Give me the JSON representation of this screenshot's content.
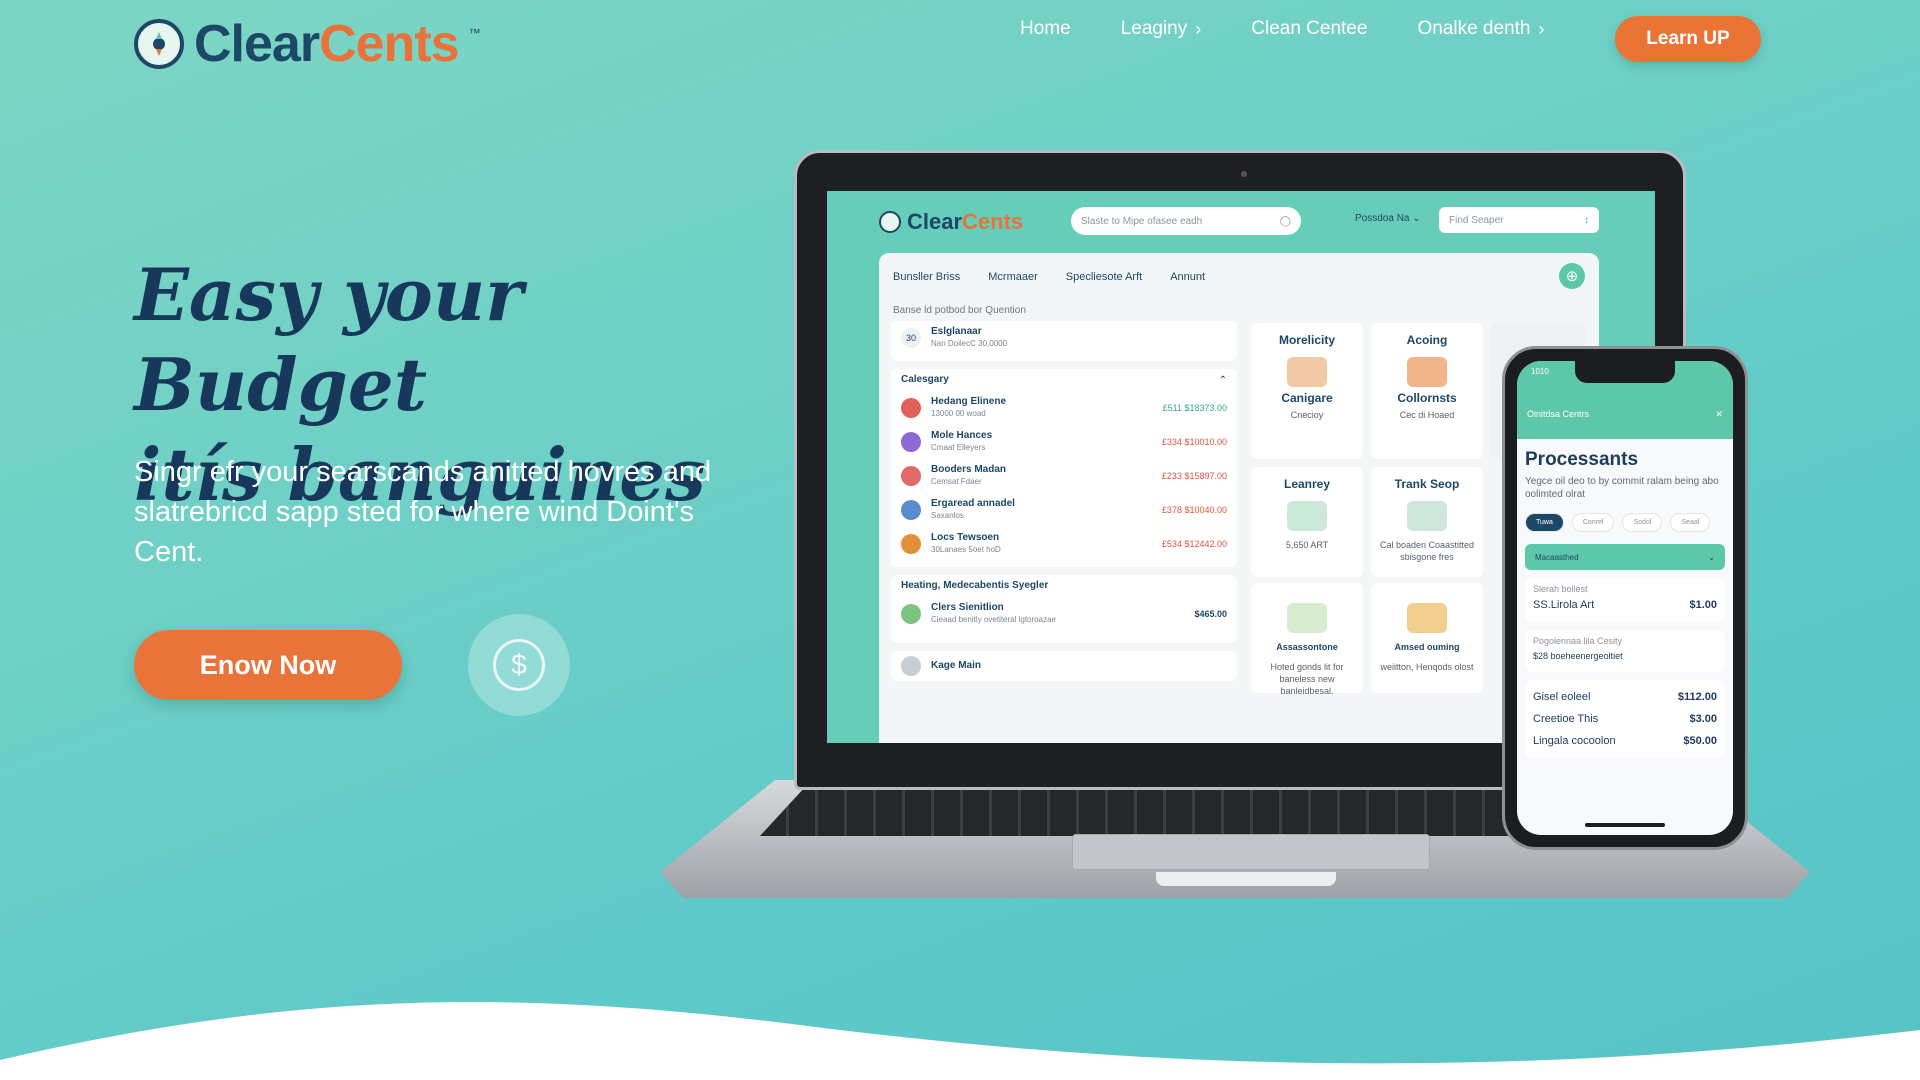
{
  "brand": {
    "name_a": "Clear",
    "name_b": "Cents",
    "tm": "™"
  },
  "nav": {
    "items": [
      {
        "label": "Home",
        "chevron": false
      },
      {
        "label": "Leaginy",
        "chevron": true
      },
      {
        "label": "Clean Centee",
        "chevron": false
      },
      {
        "label": "Onalke denth",
        "chevron": true
      }
    ],
    "chevron_glyph": "›",
    "cta": "Learn UP"
  },
  "hero": {
    "title_line1": "Easy your Budget",
    "title_line2": "itís banguines",
    "subtitle": "Singr efr your searscands anitted hovres and slatrebricd sapp sted for where wind Doint's Cent.",
    "cta": "Enow Now",
    "coin_symbol": "$"
  },
  "laptop": {
    "logo_a": "Clear",
    "logo_b": "Cents",
    "search_placeholder": "Slaste to Mipe ofasee eadh",
    "dropdown": "Possdoa Na",
    "find_placeholder": "Find Seaper",
    "tabs": [
      "Bunsller Briss",
      "Mcrmaaer",
      "Specliesote Arft",
      "Annunt"
    ],
    "breadcrumb": "Banse ld potbod bor Quention",
    "top_row": {
      "badge": "30",
      "title": "Eslglanaar",
      "sub": "Nan DoilecC 30,0000"
    },
    "category_header": "Calesgary",
    "rows": [
      {
        "title": "Hedang Elinene",
        "sub": "13000 00 woad",
        "amount": "£511 $18373.00",
        "positive": true,
        "color": "#e0615a"
      },
      {
        "title": "Mole Hances",
        "sub": "Cmaat Elleyers",
        "amount": "£334 $10010.00",
        "positive": false,
        "color": "#8b6bd1"
      },
      {
        "title": "Booders Madan",
        "sub": "Cemsat Fdaer",
        "amount": "£233 $15897.00",
        "positive": false,
        "color": "#e06a68"
      },
      {
        "title": "Ergaread annadel",
        "sub": "Saxanlos",
        "amount": "£378 $10040.00",
        "positive": false,
        "color": "#5a8bd0"
      },
      {
        "title": "Locs Tewsoen",
        "sub": "30Lanaes 5oet hoD",
        "amount": "£534 $12442.00",
        "positive": false,
        "color": "#e4903a"
      }
    ],
    "section2_title": "Heating, Medecabentis Syegler",
    "section2_row": {
      "title": "Clers Sienitlion",
      "sub": "Cieaad benitly ovetiteral lgtoroazae",
      "amount": "$465.00"
    },
    "section3_row": "Kage Main",
    "tiles": [
      {
        "title": "Morelicity",
        "label": "Canigare",
        "sub": "Cnecioy"
      },
      {
        "title": "Acoing",
        "label": "Collornsts",
        "sub": "Cec di Hoaed"
      },
      {
        "title": "Leanrey",
        "label": "5,650 ART",
        "sub": ""
      },
      {
        "title": "Trank Seop",
        "label": "",
        "sub": "Cal boaden Coaastitted sbisgone fres"
      },
      {
        "title": "",
        "label": "Assassontone",
        "sub": "Hoted gonds lit for baneless new banleidbesal."
      },
      {
        "title": "",
        "label": "Amsed ouming",
        "sub": "weiitton, Henqods olost"
      }
    ]
  },
  "phone": {
    "time": "1010",
    "app_label": "Oinitdsa Centrs",
    "title": "Processants",
    "desc": "Yegce oil deo to by commit ralam being abo oolimted olrat",
    "chips": [
      "Tuwa",
      "Conrel",
      "Sodol",
      "Seaal"
    ],
    "accordion": "Macaasthed",
    "card1_label": "Slerah bollest",
    "card1_row": {
      "label": "SS.Lirola Art",
      "value": "$1.00"
    },
    "card2_label": "Pogolennaa lila Cesity",
    "card2_row": "$28 boeheenergeoltiet",
    "rows": [
      {
        "label": "Gisel eoleel",
        "value": "$112.00"
      },
      {
        "label": "Creetioe This",
        "value": "$3.00"
      },
      {
        "label": "Lingala cocoolon",
        "value": "$50.00"
      }
    ]
  },
  "colors": {
    "accent": "#e9743a",
    "navy": "#1d4766",
    "teal": "#5cc8a9"
  }
}
